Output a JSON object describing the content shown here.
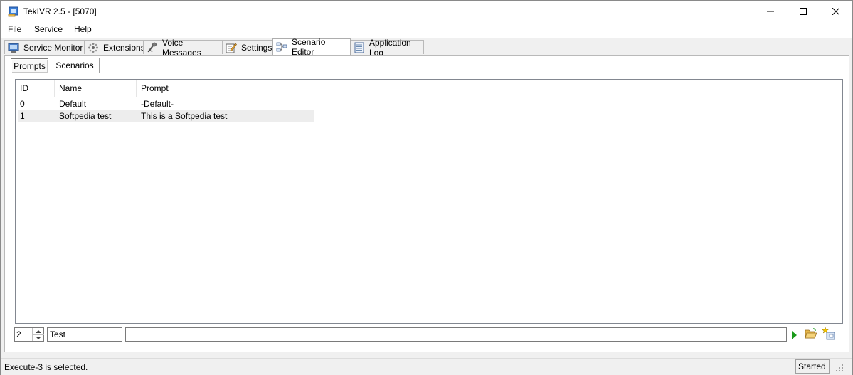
{
  "window": {
    "title": "TekIVR 2.5 - [5070]"
  },
  "menu": [
    "File",
    "Service",
    "Help"
  ],
  "tabs": [
    {
      "label": "Service Monitor",
      "icon": "monitor-icon"
    },
    {
      "label": "Extensions",
      "icon": "extensions-icon"
    },
    {
      "label": "Voice Messages",
      "icon": "voice-messages-icon"
    },
    {
      "label": "Settings",
      "icon": "settings-icon"
    },
    {
      "label": "Scenario Editor",
      "icon": "scenario-editor-icon",
      "active": true
    },
    {
      "label": "Application Log",
      "icon": "application-log-icon"
    }
  ],
  "subtabs": [
    {
      "label": "Prompts",
      "active": true
    },
    {
      "label": "Scenarios"
    }
  ],
  "table": {
    "columns": [
      "ID",
      "Name",
      "Prompt"
    ],
    "rows": [
      [
        "0",
        "Default",
        "-Default-"
      ],
      [
        "1",
        "Softpedia test",
        "This is a Softpedia test"
      ]
    ]
  },
  "editor": {
    "id_value": "2",
    "name_value": "Test",
    "prompt_value": ""
  },
  "status": {
    "message": "Execute-3 is selected.",
    "state": "Started"
  }
}
